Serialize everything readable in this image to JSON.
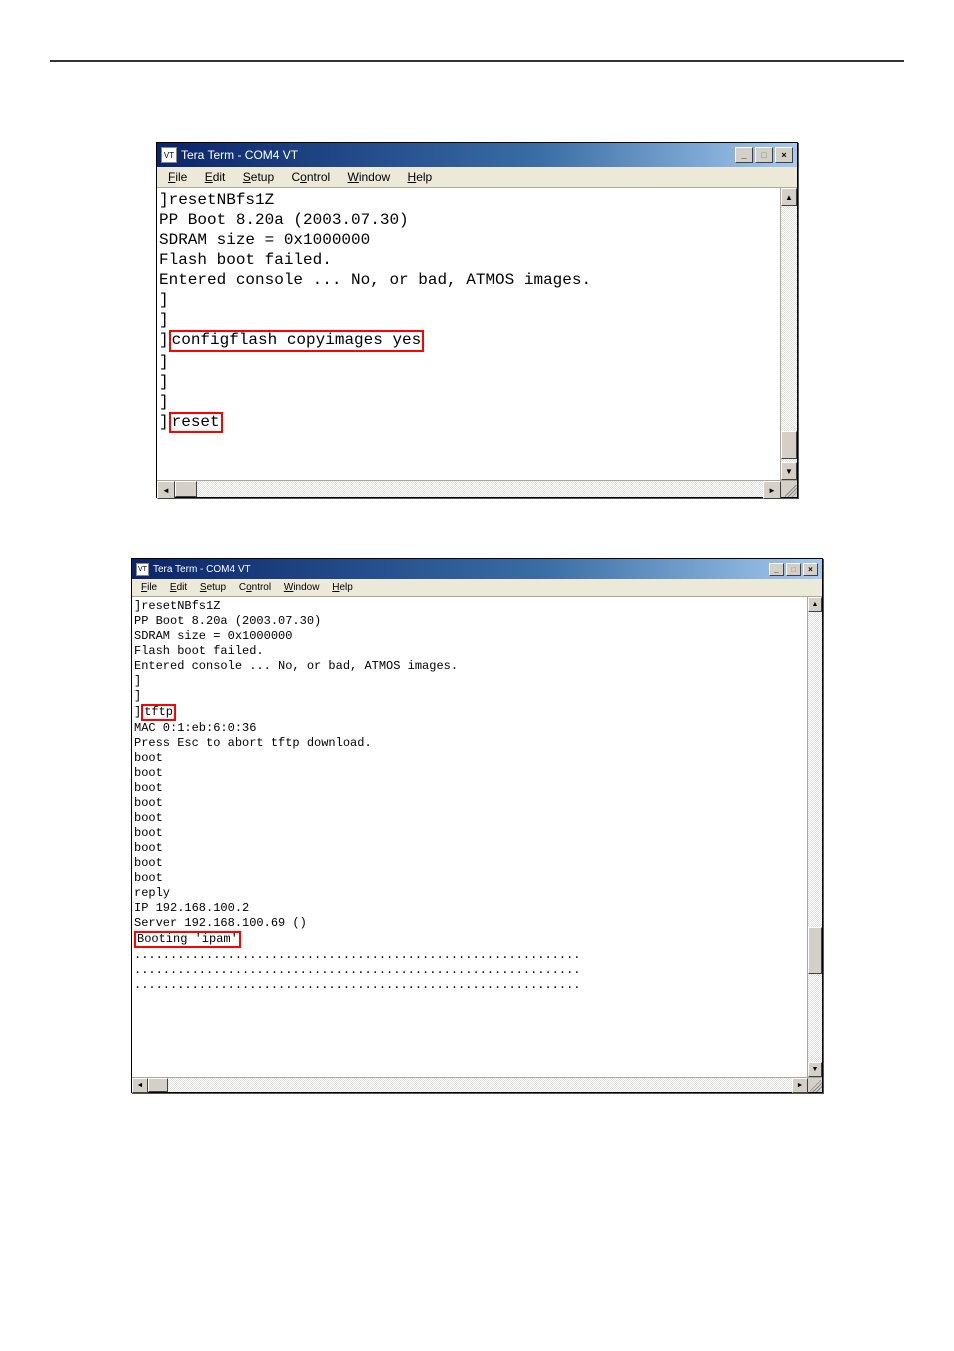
{
  "window_title": "Tera Term - COM4 VT",
  "menu": {
    "file": "File",
    "edit": "Edit",
    "setup": "Setup",
    "control": "Control",
    "window": "Window",
    "help": "Help"
  },
  "win_controls": {
    "minimize": "_",
    "maximize": "□",
    "close": "×"
  },
  "scroll": {
    "up": "▲",
    "down": "▼",
    "left": "◄",
    "right": "►"
  },
  "term1": {
    "l1": "]resetNBfs1Z",
    "l2": "PP Boot 8.20a (2003.07.30)",
    "l3": "",
    "l4": "SDRAM size = 0x1000000",
    "l5": "Flash boot failed.",
    "l6": "",
    "l7": "Entered console ... No, or bad, ATMOS images.",
    "l8": "]",
    "l9": "]",
    "l10a": "]",
    "l10b": "configflash copyimages yes",
    "l11": "]",
    "l12": "]",
    "l13": "]",
    "l14a": "]",
    "l14b": "reset"
  },
  "term2": {
    "l1": "]resetNBfs1Z",
    "l2": "PP Boot 8.20a (2003.07.30)",
    "l3": "",
    "l4": "SDRAM size = 0x1000000",
    "l5": "Flash boot failed.",
    "l6": "",
    "l7": "Entered console ... No, or bad, ATMOS images.",
    "l8": "]",
    "l9": "]",
    "l10a": "]",
    "l10b": "tftp",
    "l11": "MAC 0:1:eb:6:0:36",
    "l12": "Press Esc to abort tftp download.",
    "l13": "boot",
    "l14": "boot",
    "l15": "boot",
    "l16": "boot",
    "l17": "boot",
    "l18": "boot",
    "l19": "boot",
    "l20": "boot",
    "l21": "boot",
    "l22": "reply",
    "l23": "IP 192.168.100.2",
    "l24": "Server 192.168.100.69 ()",
    "l25": "Booting 'ipam'",
    "l26": "..............................................................",
    "l27": "..............................................................",
    "l28": ".............................................................."
  }
}
